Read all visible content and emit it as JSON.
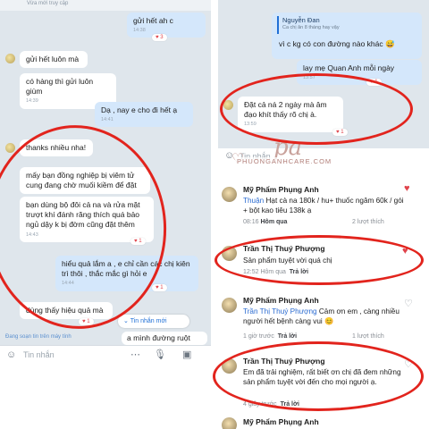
{
  "left_chat": {
    "status": "Vừa mới truy cập",
    "messages": [
      {
        "text": "gửi hết ah c",
        "time": "14:38",
        "reactions": "3"
      },
      {
        "text": "gửi hết luôn mà",
        "time": "",
        "reactions": ""
      },
      {
        "text": "có hàng thì gửi luôn giùm",
        "time": "14:39",
        "reactions": ""
      },
      {
        "text": "Dạ , nay e cho đi hết ạ",
        "time": "14:41",
        "reactions": ""
      },
      {
        "text": "thanks nhiều nha!",
        "time": "",
        "reactions": ""
      },
      {
        "text": "mấy bạn đồng nghiệp bị viêm tử cung đang chờ muối kiềm để đặt",
        "time": "",
        "reactions": ""
      },
      {
        "text": "bạn dùng bộ đôi cả na và rửa mặt trượt khí đánh răng thích quá bảo ngủ dậy k bị đờm cũng đặt thêm",
        "time": "14:43",
        "reactions": "1"
      },
      {
        "text": "hiểu quả lắm a , e chỉ cần các chị kiên trì thôi , thắc mắc gì hỏi e",
        "time": "14:44",
        "reactions": "1"
      },
      {
        "text": "dùng thấy hiệu quả mà",
        "time": "",
        "reactions": "1"
      },
      {
        "text": "a mình đường ruột",
        "time": "",
        "reactions": ""
      }
    ],
    "new_messages_label": "Tin nhắn mới",
    "typing": "Đang soạn tin trên máy tính",
    "input_placeholder": "Tin nhắn"
  },
  "right_chat": {
    "quoted_name": "Nguyễn Đan",
    "quoted_meta": "Ca chị ăn 8 tháng hay vậy",
    "quoted_message": "vì c kg có con đường nào khác 😅",
    "message_1": "lay mẹ Quan Anh mỗi ngày",
    "message_1_time": "13:57",
    "message_2": "Đặt cả ná 2 ngày mà âm đạo khít thấy rõ chị à.",
    "message_2_time": "13:59",
    "input_placeholder": "Tin nhắn",
    "watermark": "PHUONGANHCARE.COM",
    "logo": "pa"
  },
  "comments": [
    {
      "name": "Mỹ Phẩm Phụng Anh",
      "mention": "Thuận",
      "text": " Hạt cà na 180k / hu+ thuốc ngâm 60k / gói + bột kao tiêu 138k ạ",
      "time": "08:16",
      "action": "Hôm qua",
      "likes": "2 lượt thích"
    },
    {
      "name": "Trần Thị Thuý Phượng",
      "mention": "",
      "text": "Sản phẩm tuyệt vời quá chị",
      "time": "12:52",
      "action": "Hôm qua",
      "reply": "Trả lời"
    },
    {
      "name": "Mỹ Phẩm Phụng Anh",
      "mention": "Trần Thị Thuý Phượng",
      "text": " Cảm ơn em , càng nhiều người hết bệnh càng vui 😊",
      "time": "1 giờ trước",
      "reply": "Trả lời",
      "likes": "1 lượt thích"
    },
    {
      "name": "Trần Thị Thuý Phượng",
      "mention": "",
      "text": "Em đã trải nghiệm, rất biết ơn chị đã đem những sản phẩm tuyệt vời đến cho mọi người ạ.",
      "time": "4 giây trước",
      "reply": "Trả lời"
    },
    {
      "name": "Mỹ Phẩm Phụng Anh",
      "mention": "",
      "text": "",
      "time": "",
      "reply": ""
    }
  ],
  "colors": {
    "highlight_ring": "#e2241d",
    "chat_bg": "#dfe6ec",
    "my_bubble": "#d4e7fb",
    "link_blue": "#2a6bd1"
  }
}
